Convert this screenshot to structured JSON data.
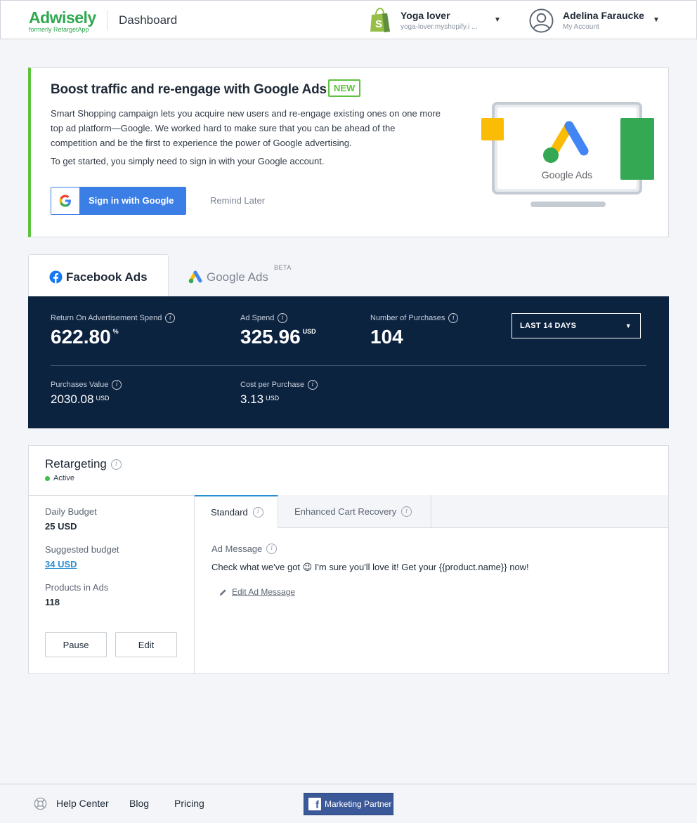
{
  "header": {
    "logo": "Adwisely",
    "logo_sub": "formerly RetargetApp",
    "title": "Dashboard",
    "shop_name": "Yoga lover",
    "shop_url": "yoga-lover.myshopify.i ...",
    "user_name": "Adelina Faraucke",
    "user_sub": "My Account"
  },
  "promo": {
    "title": "Boost traffic and re-engage with Google Ads",
    "badge": "NEW",
    "text": "Smart Shopping campaign lets you acquire new users and re-engage existing ones on one more top ad platform—Google. We worked hard to make sure that you can be ahead of the competition and be the first to experience the power of Google advertising.",
    "text2": "To get started, you simply need to sign in with your Google account.",
    "sign_in": "Sign in with Google",
    "remind": "Remind Later",
    "art_label": "Google Ads"
  },
  "tabs": {
    "facebook": "Facebook Ads",
    "google": "Google Ads",
    "google_badge": "BETA"
  },
  "stats": {
    "roas_label": "Return On Advertisement Spend",
    "roas_value": "622.80",
    "roas_unit": "%",
    "spend_label": "Ad Spend",
    "spend_value": "325.96",
    "spend_unit": "USD",
    "purchases_label": "Number of Purchases",
    "purchases_value": "104",
    "range": "LAST 14 DAYS",
    "pv_label": "Purchases Value",
    "pv_value": "2030.08",
    "pv_unit": "USD",
    "cpp_label": "Cost per Purchase",
    "cpp_value": "3.13",
    "cpp_unit": "USD"
  },
  "retargeting": {
    "title": "Retargeting",
    "status": "Active",
    "daily_budget_label": "Daily Budget",
    "daily_budget_value": "25 USD",
    "suggested_label": "Suggested budget",
    "suggested_value": "34 USD",
    "products_label": "Products in Ads",
    "products_value": "118",
    "pause": "Pause",
    "edit": "Edit",
    "tab_standard": "Standard",
    "tab_ecr": "Enhanced Cart Recovery",
    "ad_msg_label": "Ad Message",
    "ad_msg_text": "Check what we've got 😉 I'm sure you'll love it! Get your {{product.name}} now!",
    "edit_msg": "Edit Ad Message"
  },
  "footer": {
    "help": "Help Center",
    "blog": "Blog",
    "pricing": "Pricing",
    "partner": "Marketing Partner"
  },
  "colors": {
    "brand_green": "#2fa84f",
    "accent_green": "#5cc33d",
    "google_blue": "#3b7ee6",
    "stats_bg": "#0c2340",
    "link_blue": "#2b8fd6",
    "facebook_blue": "#3b5998"
  }
}
